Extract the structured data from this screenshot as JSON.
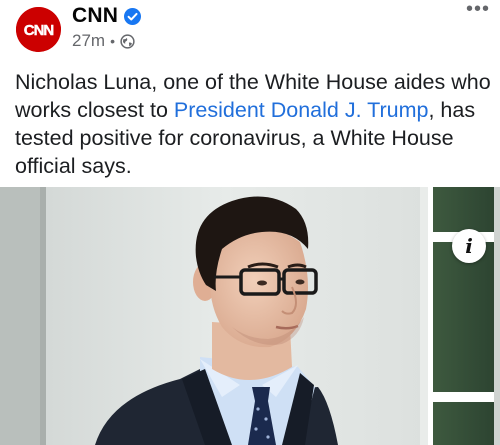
{
  "post": {
    "author": "CNN",
    "avatar_text": "CNN",
    "time": "27m",
    "separator": "•",
    "more_label": "•••",
    "text_before": "Nicholas Luna, one of the White House aides who works closest to ",
    "text_link": "President Donald J. Trump",
    "text_after": ", has tested positive for coronavirus, a White House official says."
  },
  "photo": {
    "info_label": "i"
  },
  "colors": {
    "brand_red": "#cc0000",
    "link_blue": "#216fdb",
    "verified_blue": "#1877f2",
    "meta_gray": "#65676b"
  },
  "icons": {
    "verified": "verified-badge-icon",
    "privacy": "globe-icon",
    "more": "more-options-icon",
    "info": "info-icon"
  }
}
